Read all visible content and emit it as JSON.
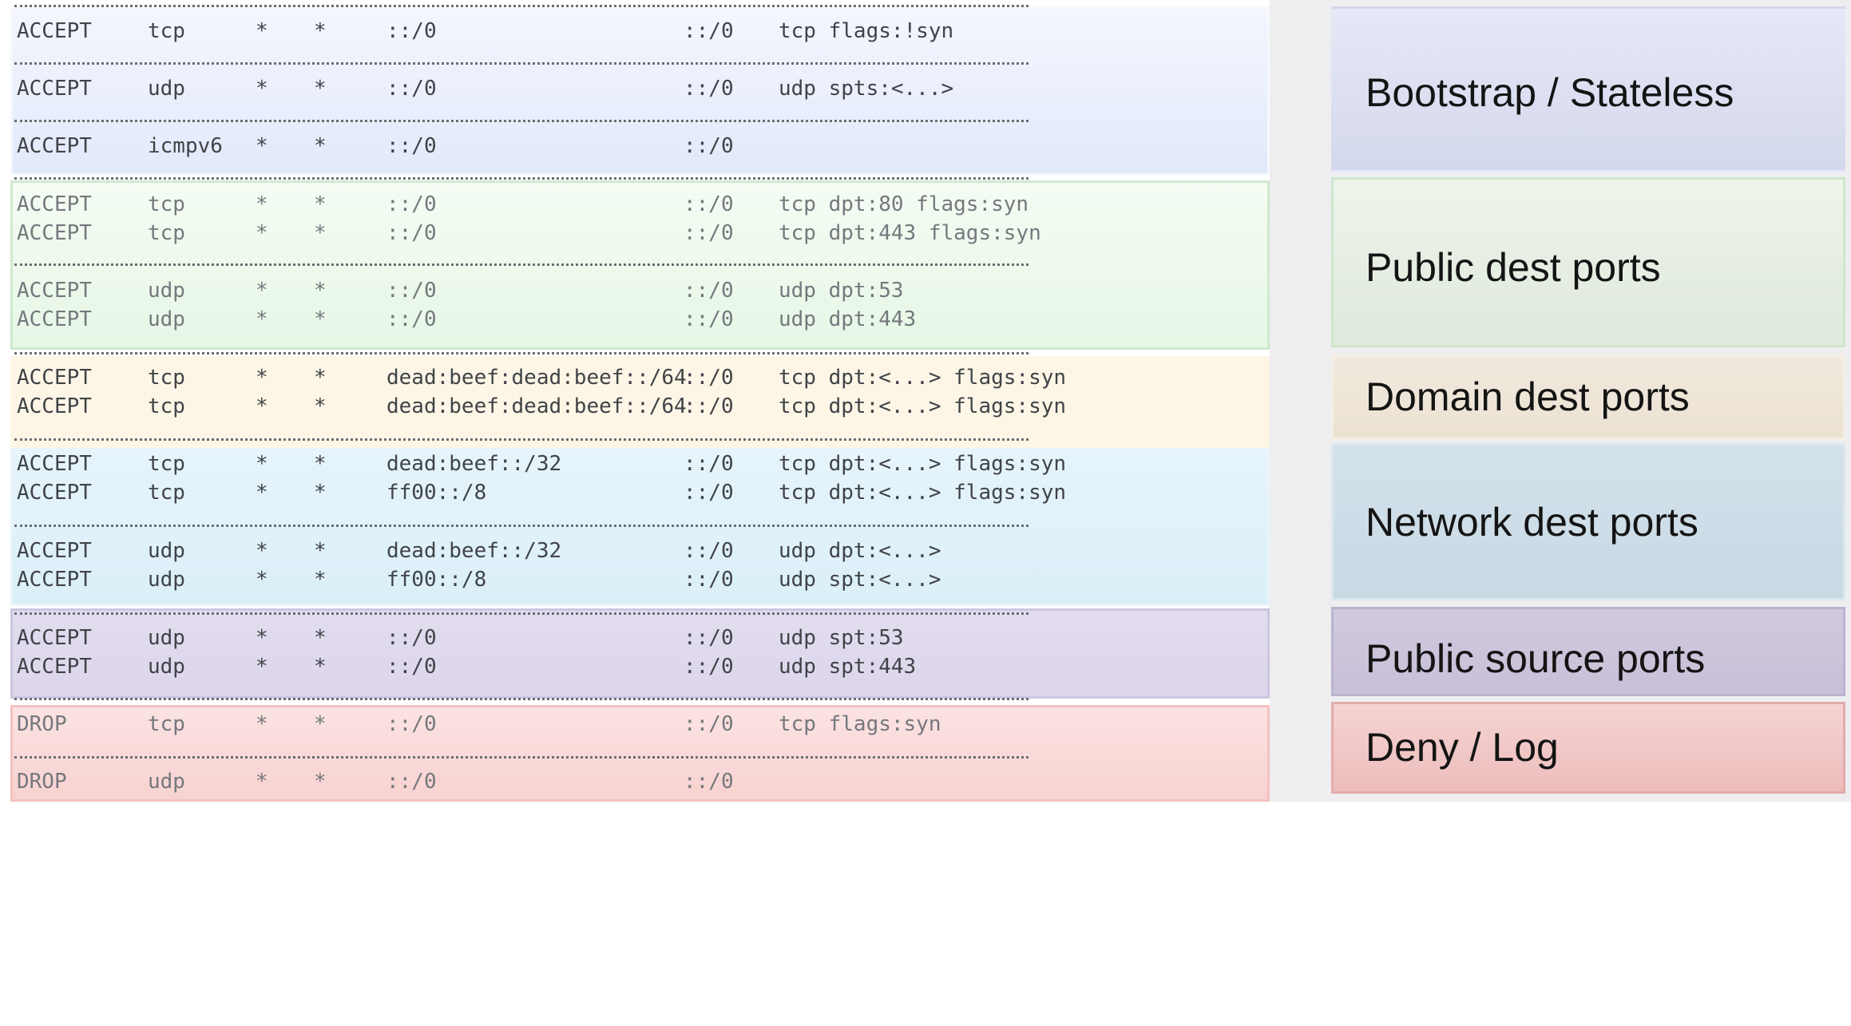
{
  "rule_sections": [
    {
      "id": "bootstrap",
      "rules": [
        {
          "action": "ACCEPT",
          "protocol": "tcp",
          "in": "*",
          "out": "*",
          "source": "::/0",
          "destination": "::/0",
          "options": "tcp flags:!syn"
        },
        {
          "action": "ACCEPT",
          "protocol": "udp",
          "in": "*",
          "out": "*",
          "source": "::/0",
          "destination": "::/0",
          "options": "udp spts:<...>"
        },
        {
          "action": "ACCEPT",
          "protocol": "icmpv6",
          "in": "*",
          "out": "*",
          "source": "::/0",
          "destination": "::/0",
          "options": ""
        }
      ]
    },
    {
      "id": "public-dest",
      "rules": [
        {
          "action": "ACCEPT",
          "protocol": "tcp",
          "in": "*",
          "out": "*",
          "source": "::/0",
          "destination": "::/0",
          "options": "tcp dpt:80 flags:syn"
        },
        {
          "action": "ACCEPT",
          "protocol": "tcp",
          "in": "*",
          "out": "*",
          "source": "::/0",
          "destination": "::/0",
          "options": "tcp dpt:443 flags:syn"
        },
        {
          "action": "ACCEPT",
          "protocol": "udp",
          "in": "*",
          "out": "*",
          "source": "::/0",
          "destination": "::/0",
          "options": "udp dpt:53"
        },
        {
          "action": "ACCEPT",
          "protocol": "udp",
          "in": "*",
          "out": "*",
          "source": "::/0",
          "destination": "::/0",
          "options": "udp dpt:443"
        }
      ]
    },
    {
      "id": "domain-dest",
      "rules": [
        {
          "action": "ACCEPT",
          "protocol": "tcp",
          "in": "*",
          "out": "*",
          "source": "dead:beef:dead:beef::/64",
          "destination": "::/0",
          "options": "tcp dpt:<...> flags:syn"
        },
        {
          "action": "ACCEPT",
          "protocol": "tcp",
          "in": "*",
          "out": "*",
          "source": "dead:beef:dead:beef::/64",
          "destination": "::/0",
          "options": "tcp dpt:<...> flags:syn"
        }
      ]
    },
    {
      "id": "network-dest",
      "rules": [
        {
          "action": "ACCEPT",
          "protocol": "tcp",
          "in": "*",
          "out": "*",
          "source": "dead:beef::/32",
          "destination": "::/0",
          "options": "tcp dpt:<...> flags:syn"
        },
        {
          "action": "ACCEPT",
          "protocol": "tcp",
          "in": "*",
          "out": "*",
          "source": "ff00::/8",
          "destination": "::/0",
          "options": "tcp dpt:<...> flags:syn"
        },
        {
          "action": "ACCEPT",
          "protocol": "udp",
          "in": "*",
          "out": "*",
          "source": "dead:beef::/32",
          "destination": "::/0",
          "options": "udp dpt:<...>"
        },
        {
          "action": "ACCEPT",
          "protocol": "udp",
          "in": "*",
          "out": "*",
          "source": "ff00::/8",
          "destination": "::/0",
          "options": "udp spt:<...>"
        }
      ]
    },
    {
      "id": "public-source",
      "rules": [
        {
          "action": "ACCEPT",
          "protocol": "udp",
          "in": "*",
          "out": "*",
          "source": "::/0",
          "destination": "::/0",
          "options": "udp spt:53"
        },
        {
          "action": "ACCEPT",
          "protocol": "udp",
          "in": "*",
          "out": "*",
          "source": "::/0",
          "destination": "::/0",
          "options": "udp spt:443"
        }
      ]
    },
    {
      "id": "deny-log",
      "rules": [
        {
          "action": "DROP",
          "protocol": "tcp",
          "in": "*",
          "out": "*",
          "source": "::/0",
          "destination": "::/0",
          "options": "tcp flags:syn"
        },
        {
          "action": "DROP",
          "protocol": "udp",
          "in": "*",
          "out": "*",
          "source": "::/0",
          "destination": "::/0",
          "options": ""
        }
      ]
    }
  ],
  "categories": [
    {
      "label": "Bootstrap / Stateless",
      "color": "#d4d8ec"
    },
    {
      "label": "Public dest ports",
      "color": "#e3ece0"
    },
    {
      "label": "Domain dest ports",
      "color": "#ede4d6"
    },
    {
      "label": "Network dest ports",
      "color": "#ccdce6"
    },
    {
      "label": "Public source ports",
      "color": "#cbc3da"
    },
    {
      "label": "Deny / Log",
      "color": "#f0c6c5"
    }
  ],
  "colors": {
    "text_dark": "#404347",
    "text_dim": "#75787d",
    "right_panel_bg": "#eeeef1"
  }
}
